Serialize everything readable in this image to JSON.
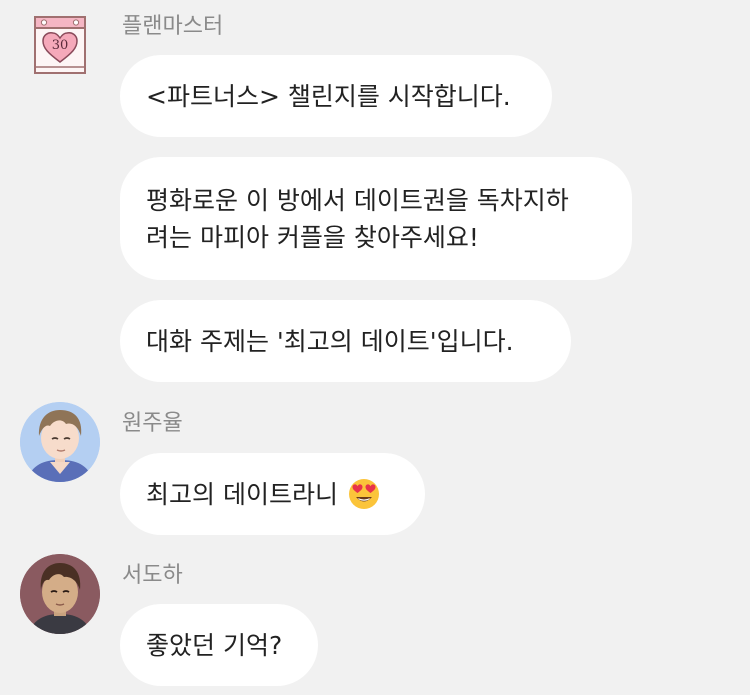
{
  "messages": [
    {
      "sender": "플랜마스터",
      "bubbles": [
        {
          "lines": [
            "<파트너스> 챌린지를 시작합니다."
          ]
        },
        {
          "lines": [
            "평화로운 이 방에서 데이트권을 독차지하",
            "려는 마피아 커플을 찾아주세요!"
          ]
        },
        {
          "lines": [
            "대화 주제는 '최고의 데이트'입니다."
          ]
        }
      ],
      "avatar_label": "30",
      "avatar_icon": "calendar-heart-icon"
    },
    {
      "sender": "원주율",
      "bubbles": [
        {
          "lines": [
            "최고의 데이트라니"
          ],
          "emoji": "heart-eyes-emoji-icon"
        }
      ],
      "avatar_icon": "avatar-man-light-hair"
    },
    {
      "sender": "서도하",
      "bubbles": [
        {
          "lines": [
            "좋았던 기억?"
          ]
        }
      ],
      "avatar_icon": "avatar-man-dark-hair"
    }
  ],
  "colors": {
    "background": "#f1f1f1",
    "bubble": "#ffffff",
    "sender_name": "#8a8a8a",
    "text": "#222222",
    "calendar_pink": "#f5b6c4",
    "calendar_border": "#a07070"
  }
}
